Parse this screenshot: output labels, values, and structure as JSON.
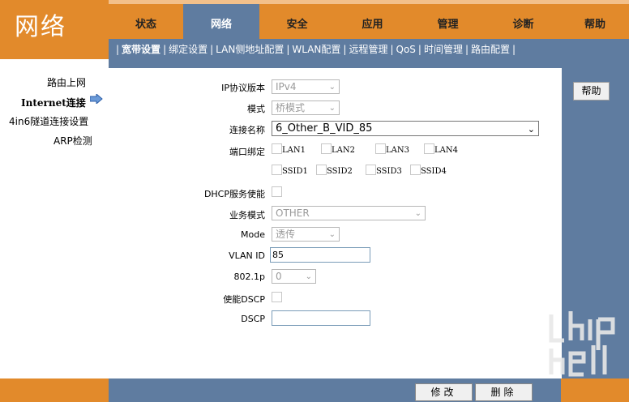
{
  "logo": {
    "text": "网络"
  },
  "top_nav": [
    {
      "label": "状态",
      "active": false
    },
    {
      "label": "网络",
      "active": true
    },
    {
      "label": "安全",
      "active": false
    },
    {
      "label": "应用",
      "active": false
    },
    {
      "label": "管理",
      "active": false
    },
    {
      "label": "诊断",
      "active": false
    },
    {
      "label": "帮助",
      "active": false
    }
  ],
  "sub_nav": [
    {
      "label": "宽带设置",
      "active": true
    },
    {
      "label": "绑定设置"
    },
    {
      "label": "LAN侧地址配置"
    },
    {
      "label": "WLAN配置"
    },
    {
      "label": "远程管理"
    },
    {
      "label": "QoS"
    },
    {
      "label": "时间管理"
    },
    {
      "label": "路由配置"
    }
  ],
  "sidebar": [
    {
      "label": "路由上网"
    },
    {
      "label": "Internet连接",
      "active": true
    },
    {
      "label": "4in6隧道连接设置"
    },
    {
      "label": "ARP检测"
    }
  ],
  "form": {
    "ip_version": {
      "label": "IP协议版本",
      "value": "IPv4"
    },
    "mode": {
      "label": "模式",
      "value": "桥模式"
    },
    "connection_name": {
      "label": "连接名称",
      "value": "6_Other_B_VID_85"
    },
    "port_binding": {
      "label": "端口绑定",
      "ports_row1": [
        "LAN1",
        "LAN2",
        "LAN3",
        "LAN4"
      ],
      "ports_row2": [
        "SSID1",
        "SSID2",
        "SSID3",
        "SSID4"
      ]
    },
    "dhcp": {
      "label": "DHCP服务使能"
    },
    "service_mode": {
      "label": "业务模式",
      "value": "OTHER"
    },
    "mode2": {
      "label": "Mode",
      "value": "透传"
    },
    "vlan_id": {
      "label": "VLAN ID",
      "value": "85"
    },
    "p8021": {
      "label": "802.1p",
      "value": "0"
    },
    "enable_dscp": {
      "label": "使能DSCP"
    },
    "dscp": {
      "label": "DSCP",
      "value": ""
    }
  },
  "help_button": "帮助",
  "footer": {
    "modify": "修改",
    "delete": "删除"
  },
  "watermark": {
    "url": "www.chiphell.com"
  },
  "colors": {
    "orange": "#e28a2b",
    "blue": "#5f7ca0"
  }
}
